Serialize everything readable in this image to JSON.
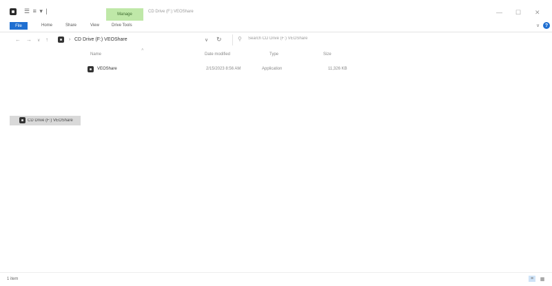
{
  "titlebar": {
    "qat": "☰ ≡ ▾ |",
    "manage_tab": "Manage",
    "window_title": "CD Drive (F:) VEOShare",
    "minimize": "—",
    "maximize": "☐",
    "close": "✕"
  },
  "ribbon": {
    "file": "File",
    "tabs": [
      "Home",
      "Share",
      "View",
      "Drive Tools"
    ],
    "chevron": "∨",
    "help": "?"
  },
  "navigation": {
    "back": "←",
    "forward": "→",
    "recent": "∨",
    "up": "↑",
    "separator": "›",
    "address": "CD Drive (F:) VEOShare",
    "address_dropdown": "∨",
    "refresh": "↻",
    "search_placeholder": "Search CD Drive (F:) VEOShare"
  },
  "file_list": {
    "columns": [
      "Name",
      "Date modified",
      "Type",
      "Size"
    ],
    "sort_arrow": "˄",
    "rows": [
      {
        "name": "VEOShare",
        "date_modified": "2/15/2023 8:56 AM",
        "type": "Application",
        "size": "11,326 KB"
      }
    ]
  },
  "nav_pane": {
    "item": "CD Drive (F:) VEOShare"
  },
  "status": {
    "item_count": "1 item",
    "details_view": "≡",
    "tiles_view": "▦"
  },
  "colors": {
    "accent": "#1f6fd1",
    "manage_tab": "#bfe8a8",
    "selected_nav": "#d9d9d9"
  }
}
